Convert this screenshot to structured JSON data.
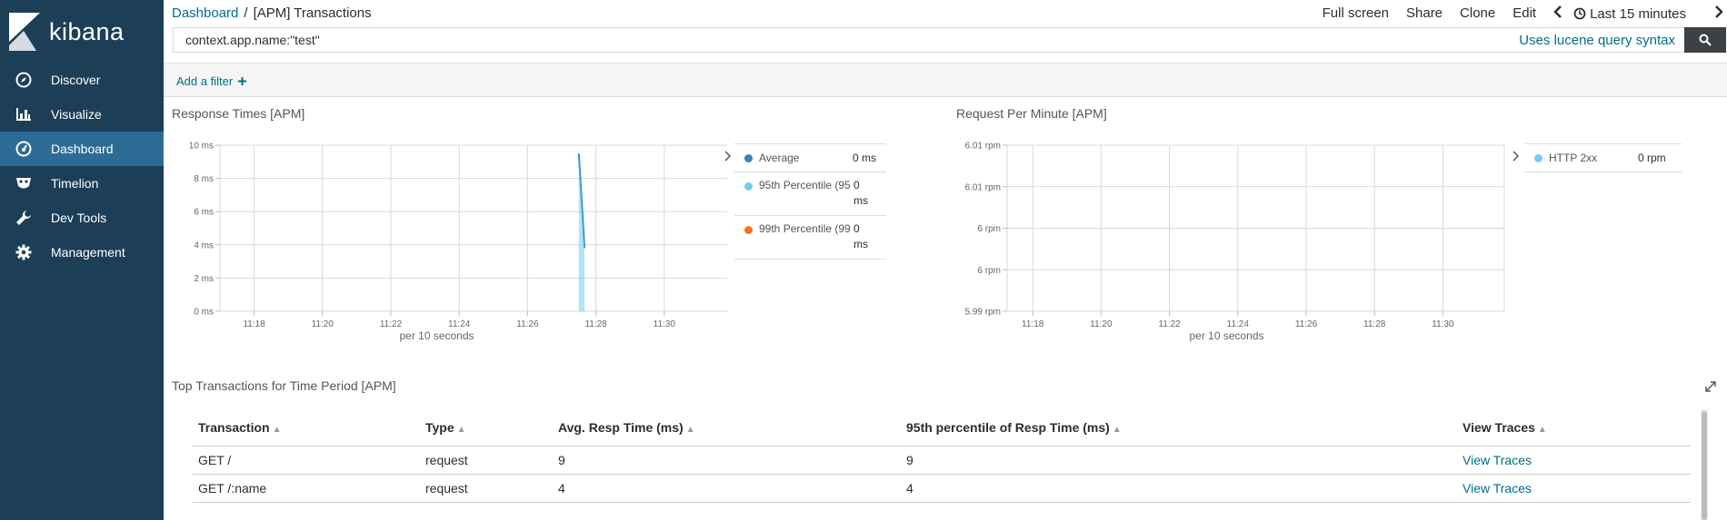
{
  "sidebar": {
    "brand": "kibana",
    "items": [
      {
        "label": "Discover",
        "icon": "compass-icon",
        "active": false
      },
      {
        "label": "Visualize",
        "icon": "bar-chart-icon",
        "active": false
      },
      {
        "label": "Dashboard",
        "icon": "dashboard-gauge-icon",
        "active": true
      },
      {
        "label": "Timelion",
        "icon": "timelion-mask-icon",
        "active": false
      },
      {
        "label": "Dev Tools",
        "icon": "wrench-icon",
        "active": false
      },
      {
        "label": "Management",
        "icon": "gear-icon",
        "active": false
      }
    ]
  },
  "header": {
    "breadcrumb_root": "Dashboard",
    "breadcrumb_sep": "/",
    "breadcrumb_current": "[APM] Transactions",
    "menu": {
      "fullscreen": "Full screen",
      "share": "Share",
      "clone": "Clone",
      "edit": "Edit",
      "time_range": "Last 15 minutes"
    }
  },
  "query": {
    "value": "context.app.name:\"test\"",
    "lucene_link": "Uses lucene query syntax"
  },
  "filter": {
    "add_label": "Add a filter"
  },
  "panels": {
    "response_times": {
      "title": "Response Times [APM]",
      "xlabel": "per 10 seconds",
      "legend": [
        {
          "name": "Average",
          "value": "0 ms"
        },
        {
          "name": "95th Percentile (95",
          "value_line1": "0",
          "value_line2": "ms"
        },
        {
          "name": "99th Percentile (99",
          "value_line1": "0",
          "value_line2": "ms"
        }
      ]
    },
    "requests_per_minute": {
      "title": "Request Per Minute [APM]",
      "xlabel": "per 10 seconds",
      "legend": [
        {
          "name": "HTTP 2xx",
          "value": "0 rpm"
        }
      ]
    },
    "top_transactions": {
      "title": "Top Transactions for Time Period [APM]",
      "columns": [
        "Transaction",
        "Type",
        "Avg. Resp Time (ms)",
        "95th percentile of Resp Time (ms)",
        "View Traces"
      ],
      "rows": [
        {
          "transaction": "GET /",
          "type": "request",
          "avg": "9",
          "p95": "9",
          "link": "View Traces"
        },
        {
          "transaction": "GET /:name",
          "type": "request",
          "avg": "4",
          "p95": "4",
          "link": "View Traces"
        }
      ]
    }
  },
  "colors": {
    "sidebar_bg": "#1c3f57",
    "sidebar_active": "#2c6c94",
    "link": "#006e8a",
    "average": "#3185c7",
    "p95": "#6fd0f3",
    "p99": "#f0761d",
    "http2xx": "#6fd0f3"
  },
  "chart_data": [
    {
      "type": "line",
      "title": "Response Times [APM]",
      "xlabel": "per 10 seconds",
      "ylabel": "",
      "x_ticks": [
        "11:18",
        "11:20",
        "11:22",
        "11:24",
        "11:26",
        "11:28",
        "11:30"
      ],
      "y_ticks": [
        "0 ms",
        "2 ms",
        "4 ms",
        "6 ms",
        "8 ms",
        "10 ms"
      ],
      "ylim": [
        0,
        10
      ],
      "series": [
        {
          "name": "Average",
          "x": [
            "11:27:30",
            "11:27:40"
          ],
          "values": [
            9.5,
            3.8
          ]
        },
        {
          "name": "95th Percentile (95",
          "x": [
            "11:27:30",
            "11:27:40"
          ],
          "values": [
            9.5,
            3.8
          ]
        },
        {
          "name": "99th Percentile (99",
          "x": [],
          "values": []
        }
      ],
      "legend": "right",
      "grid": true
    },
    {
      "type": "line",
      "title": "Request Per Minute [APM]",
      "xlabel": "per 10 seconds",
      "ylabel": "",
      "x_ticks": [
        "11:18",
        "11:20",
        "11:22",
        "11:24",
        "11:26",
        "11:28",
        "11:30"
      ],
      "y_ticks": [
        "5.99 rpm",
        "6 rpm",
        "6 rpm",
        "6.01 rpm",
        "6.01 rpm"
      ],
      "series": [
        {
          "name": "HTTP 2xx",
          "x": [],
          "values": []
        }
      ],
      "legend": "right",
      "grid": true
    }
  ]
}
